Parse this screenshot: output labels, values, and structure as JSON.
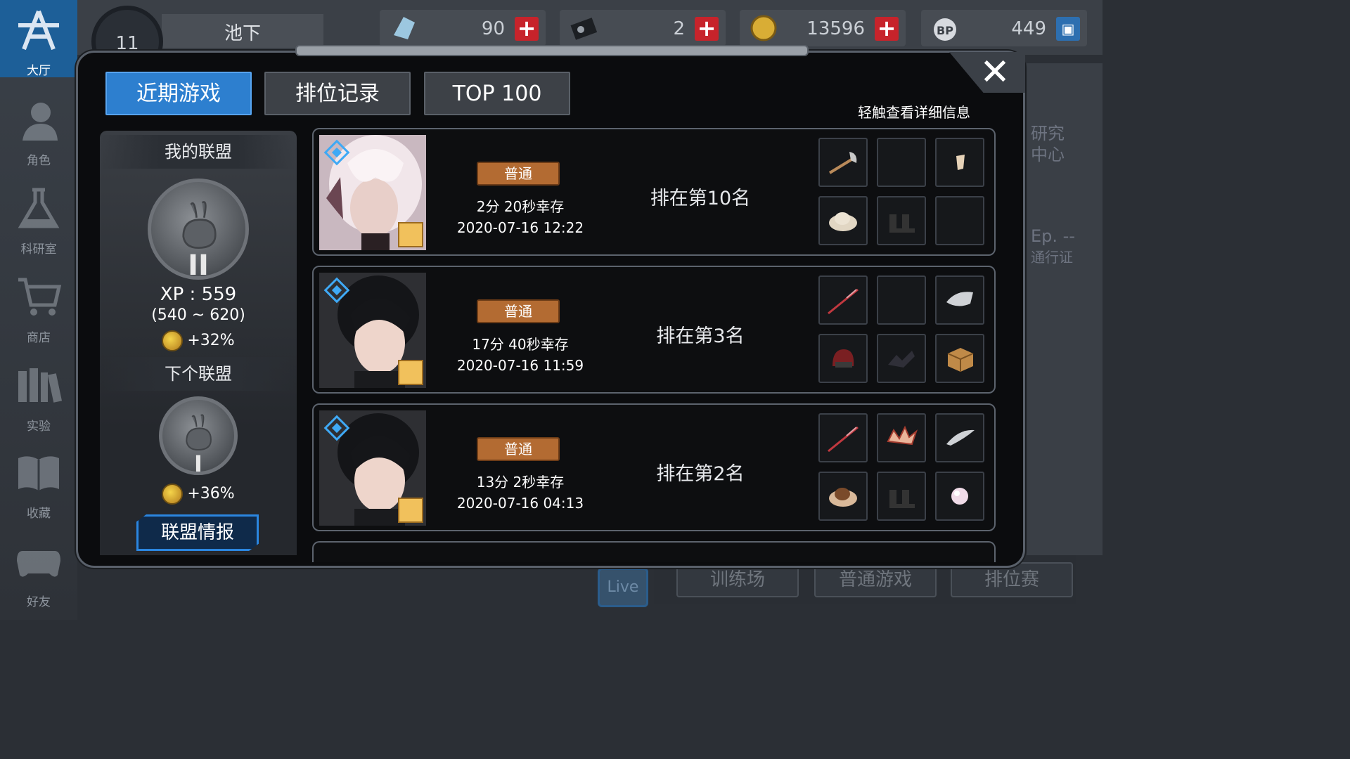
{
  "sidebar": {
    "items": [
      {
        "label": "大厅",
        "icon": "lobby-icon"
      },
      {
        "label": "角色",
        "icon": "character-icon"
      },
      {
        "label": "科研室",
        "icon": "flask-icon"
      },
      {
        "label": "商店",
        "icon": "cart-icon"
      },
      {
        "label": "实验",
        "icon": "books-icon"
      },
      {
        "label": "收藏",
        "icon": "open-book-icon"
      },
      {
        "label": "好友",
        "icon": "gamepad-icon"
      }
    ]
  },
  "topbar": {
    "level": "11",
    "player_name": "池下",
    "resources": [
      {
        "name": "crystal",
        "value": "90"
      },
      {
        "name": "ticket",
        "value": "2"
      },
      {
        "name": "coin",
        "value": "13596"
      },
      {
        "name": "bp",
        "value": "449",
        "icon_text": "BP"
      }
    ]
  },
  "background": {
    "right_text_1": "研究",
    "right_text_2": "中心",
    "right_text_3": "Ep. --",
    "right_text_4": "通行证",
    "live": "Live",
    "buttons": [
      "训练场",
      "普通游戏",
      "排位赛"
    ]
  },
  "modal": {
    "tabs": [
      "近期游戏",
      "排位记录",
      "TOP 100"
    ],
    "hint": "轻触查看详细信息",
    "close": "✕"
  },
  "league": {
    "my_title": "我的联盟",
    "my_tier": "II",
    "xp": "XP : 559",
    "xp_range": "(540 ~ 620)",
    "my_bonus": "+32%",
    "next_title": "下个联盟",
    "next_tier": "I",
    "next_bonus": "+36%",
    "info_button": "联盟情报"
  },
  "matches": [
    {
      "mode": "普通",
      "survive": "2分 20秒幸存",
      "date": "2020-07-16 12:22",
      "rank": "排在第10名",
      "character": "white-hair"
    },
    {
      "mode": "普通",
      "survive": "17分 40秒幸存",
      "date": "2020-07-16 11:59",
      "rank": "排在第3名",
      "character": "black-hair"
    },
    {
      "mode": "普通",
      "survive": "13分 2秒幸存",
      "date": "2020-07-16 04:13",
      "rank": "排在第2名",
      "character": "black-hair"
    }
  ]
}
